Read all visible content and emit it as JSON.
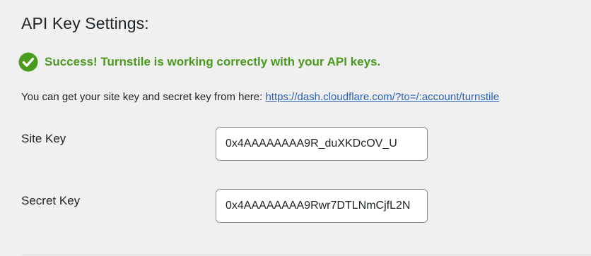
{
  "section": {
    "title": "API Key Settings:"
  },
  "notice": {
    "icon": "check-circle-icon",
    "color": "#4a9a1e",
    "text": "Success! Turnstile is working correctly with your API keys."
  },
  "help": {
    "text": "You can get your site key and secret key from here: ",
    "link_text": "https://dash.cloudflare.com/?to=/:account/turnstile"
  },
  "fields": {
    "site_key": {
      "label": "Site Key",
      "value": "0x4AAAAAAAA9R_duXKDcOV_U"
    },
    "secret_key": {
      "label": "Secret Key",
      "value": "0x4AAAAAAAA9Rwr7DTLNmCjfL2N"
    }
  }
}
